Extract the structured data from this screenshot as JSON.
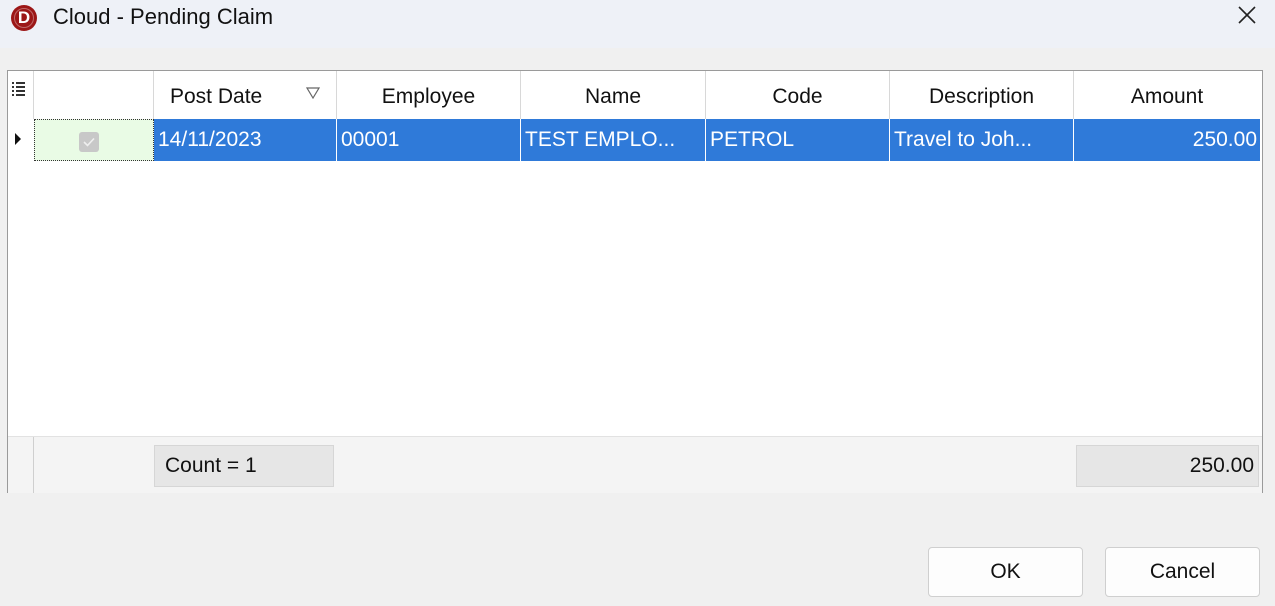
{
  "window": {
    "title": "Cloud - Pending Claim",
    "icon_letter": "D",
    "brand_color": "#9c1717"
  },
  "icons": {
    "app": "app-logo-icon",
    "close": "close-icon",
    "column_chooser": "column-chooser-icon",
    "sort": "sort-descending-icon",
    "row_indicator": "current-row-arrow-icon",
    "check": "checkmark-icon"
  },
  "grid": {
    "columns": [
      {
        "key": "post_date",
        "label": "Post Date"
      },
      {
        "key": "employee",
        "label": "Employee"
      },
      {
        "key": "name",
        "label": "Name"
      },
      {
        "key": "code",
        "label": "Code"
      },
      {
        "key": "description",
        "label": "Description"
      },
      {
        "key": "amount",
        "label": "Amount"
      }
    ],
    "rows": [
      {
        "selected": true,
        "checked": true,
        "post_date": "14/11/2023",
        "employee": "00001",
        "name": "TEST EMPLO...",
        "code": "PETROL",
        "description": "Travel to Joh...",
        "amount": "250.00"
      }
    ],
    "footer": {
      "count": "Count = 1",
      "amount_total": "250.00"
    },
    "selection_color": "#2f7ad9"
  },
  "buttons": {
    "ok": "OK",
    "cancel": "Cancel"
  }
}
